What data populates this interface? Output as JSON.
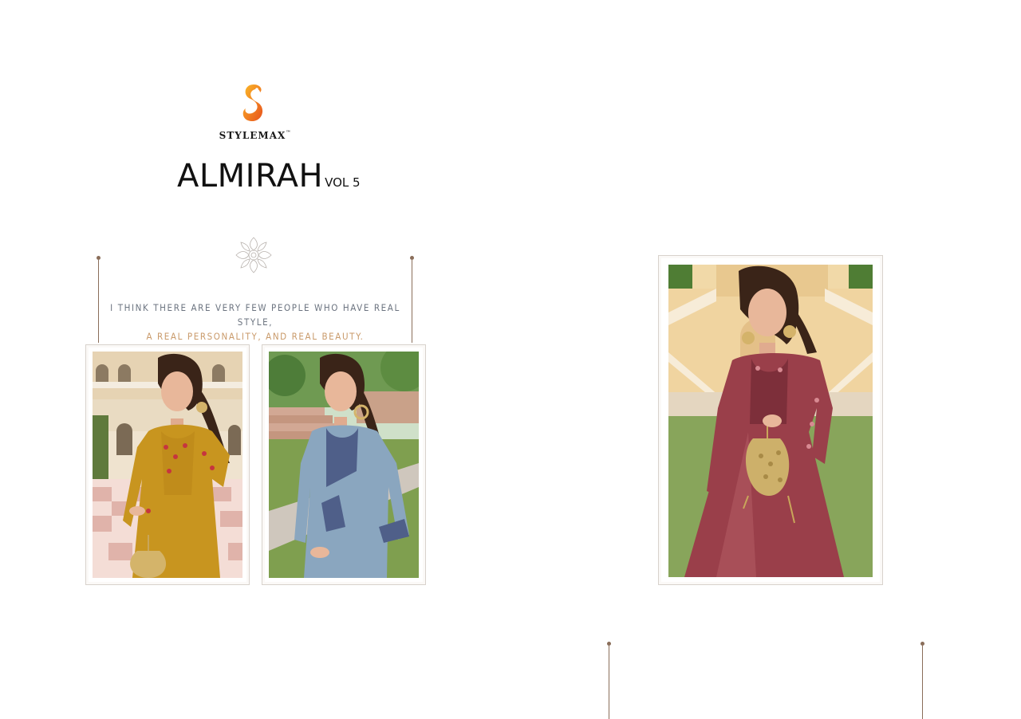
{
  "brand": {
    "name": "STYLEMAX",
    "trademark": "™",
    "logo_icon": "stylized-s-swan-logo",
    "logo_colors": [
      "#f6a21c",
      "#e8531d"
    ]
  },
  "catalog": {
    "title": "ALMIRAH",
    "volume": "VOL 5"
  },
  "quote": {
    "line1": "I think there are very few people who have real style,",
    "line2": "a real personality, and real beauty."
  },
  "photos": [
    {
      "id": "left-1",
      "dress_color": "#c8951f",
      "description_icon": "model-mustard-gown"
    },
    {
      "id": "left-2",
      "dress_color": "#8aa6bf",
      "description_icon": "model-blue-gown"
    },
    {
      "id": "right-1",
      "dress_color": "#9a3f4a",
      "description_icon": "model-maroon-gown"
    }
  ]
}
